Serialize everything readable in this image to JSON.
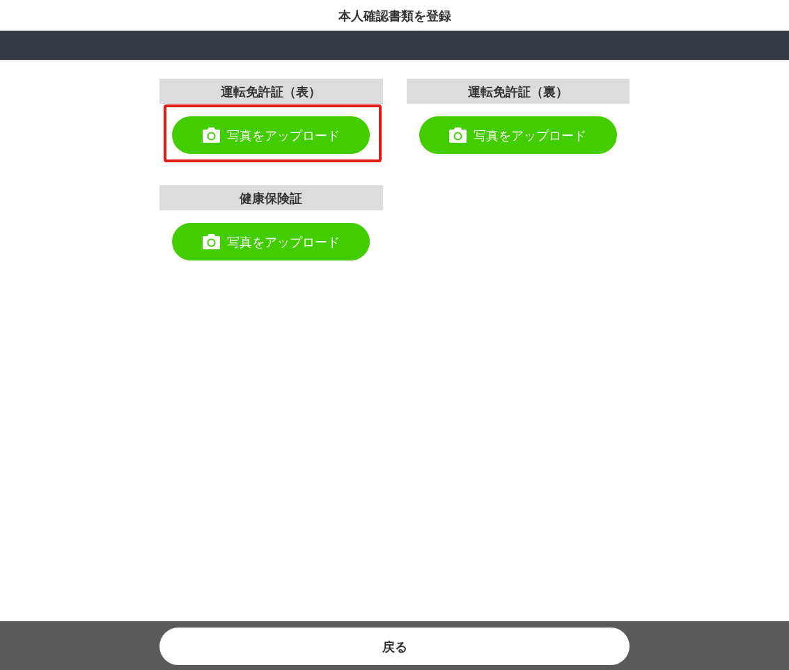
{
  "header": {
    "title": "本人確認書類を登録"
  },
  "documents": [
    {
      "label": "運転免許証（表）",
      "button": "写真をアップロード",
      "highlighted": true
    },
    {
      "label": "運転免許証（裏）",
      "button": "写真をアップロード",
      "highlighted": false
    },
    {
      "label": "健康保険証",
      "button": "写真をアップロード",
      "highlighted": false
    }
  ],
  "footer": {
    "back_button": "戻る"
  }
}
